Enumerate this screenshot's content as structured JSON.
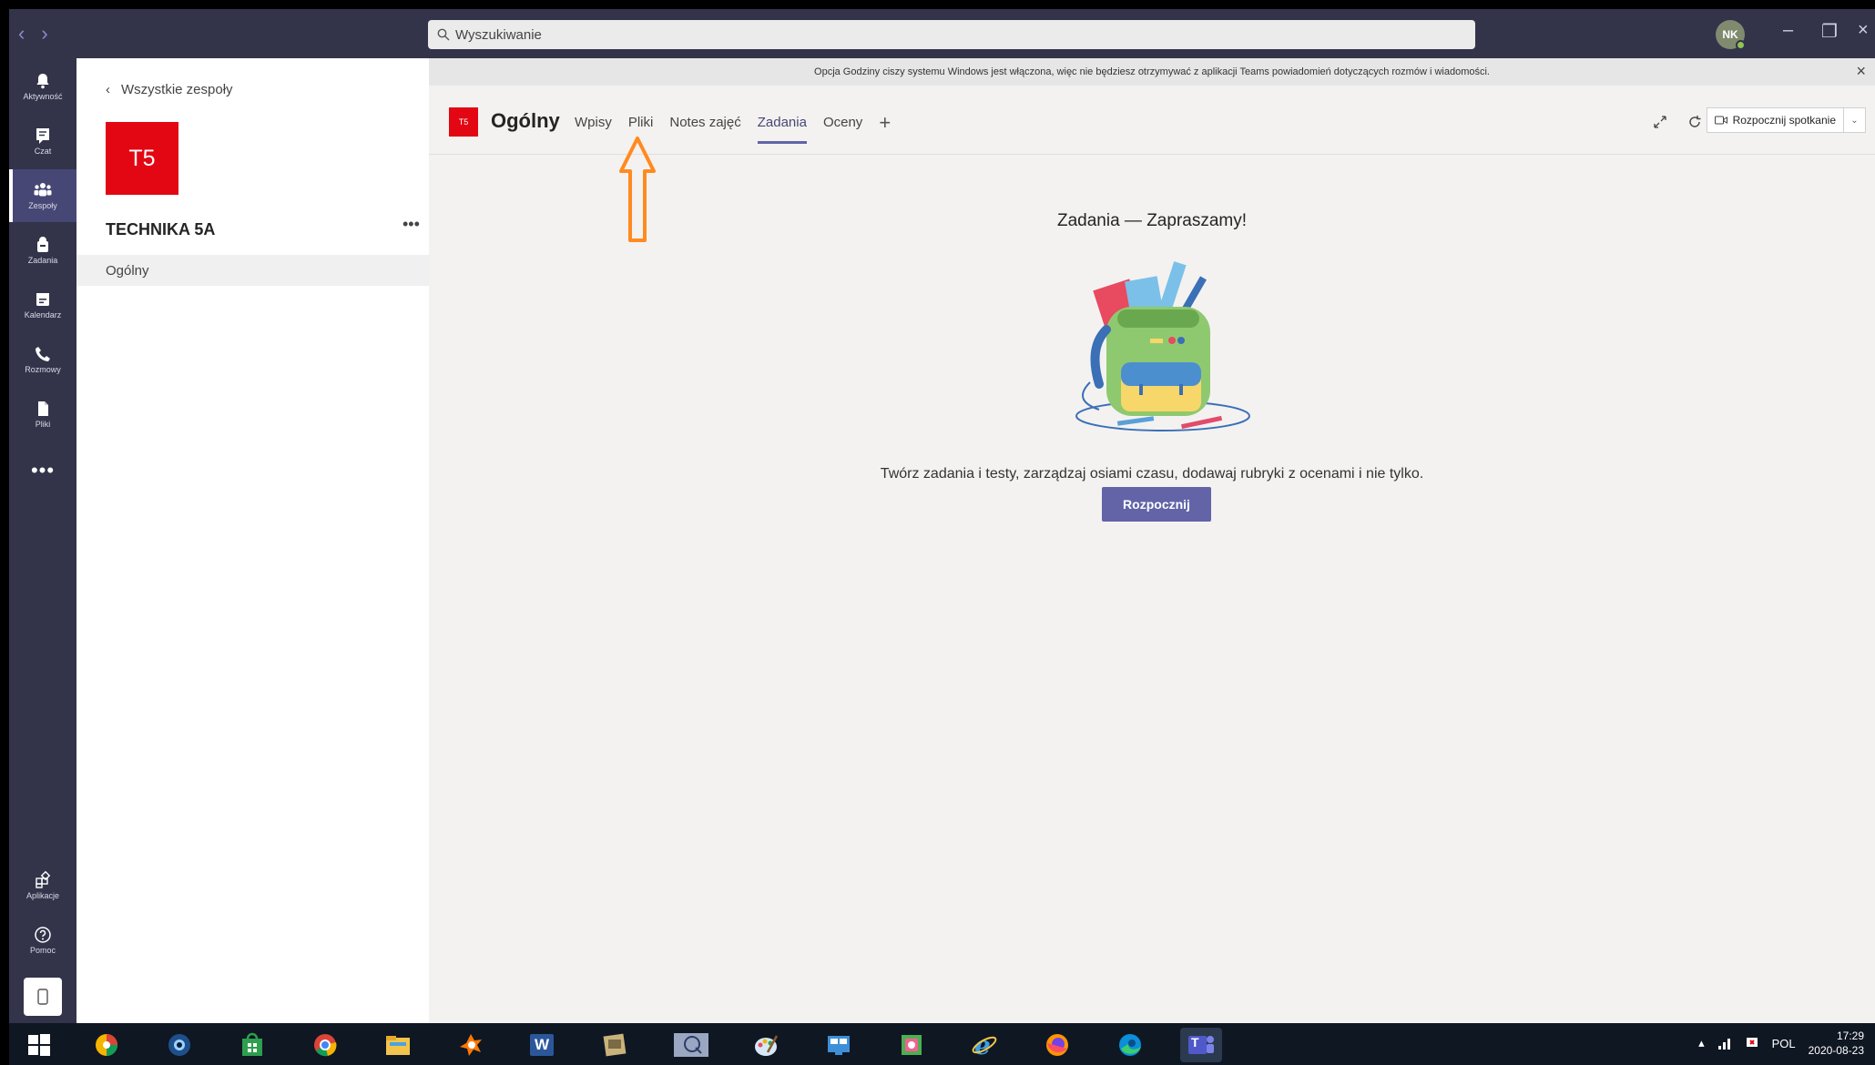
{
  "titlebar": {
    "search_placeholder": "Wyszukiwanie",
    "avatar_initials": "NK",
    "back_arrow": "‹",
    "forward_arrow": "›",
    "minimize": "–",
    "restore": "❐",
    "close": "×"
  },
  "rail": {
    "items": [
      {
        "label": "Aktywność",
        "icon": "bell-icon"
      },
      {
        "label": "Czat",
        "icon": "chat-icon"
      },
      {
        "label": "Zespoły",
        "icon": "teams-icon"
      },
      {
        "label": "Zadania",
        "icon": "assignments-icon"
      },
      {
        "label": "Kalendarz",
        "icon": "calendar-icon"
      },
      {
        "label": "Rozmowy",
        "icon": "phone-icon"
      },
      {
        "label": "Pliki",
        "icon": "file-icon"
      }
    ],
    "more": "•••",
    "bottom": [
      {
        "label": "Aplikacje",
        "icon": "apps-icon"
      },
      {
        "label": "Pomoc",
        "icon": "help-icon"
      }
    ]
  },
  "teampanel": {
    "back_label": "Wszystkie zespoły",
    "team_initials": "T5",
    "team_name": "TECHNIKA 5A",
    "more": "•••",
    "channels": [
      "Ogólny"
    ]
  },
  "notification": {
    "text": "Opcja Godziny ciszy systemu Windows jest włączona, więc nie będziesz otrzymywać z aplikacji Teams powiadomień dotyczących rozmów i wiadomości.",
    "close": "×"
  },
  "channel": {
    "badge": "T5",
    "title": "Ogólny",
    "tabs": [
      "Wpisy",
      "Pliki",
      "Notes zajęć",
      "Zadania",
      "Oceny"
    ],
    "active_tab": "Zadania",
    "add_tab": "+",
    "meet_label": "Rozpocznij spotkanie"
  },
  "main": {
    "welcome_title": "Zadania — Zapraszamy!",
    "description": "Twórz zadania i testy, zarządzaj osiami czasu, dodawaj rubryki z ocenami i nie tylko.",
    "start_button": "Rozpocznij"
  },
  "taskbar": {
    "apps": [
      "windows-start-icon",
      "picasa-icon",
      "webcam-icon",
      "store-icon",
      "chrome-icon",
      "explorer-icon",
      "avast-icon",
      "word-icon",
      "scan-icon",
      "app-icon",
      "paint-icon",
      "network-icon",
      "photo-icon",
      "ie-icon",
      "firefox-icon",
      "edge-icon",
      "teams-icon"
    ],
    "word_letter": "W",
    "teams_letter": "T",
    "language": "POL",
    "time": "17:29",
    "date": "2020-08-23"
  },
  "colors": {
    "rail": "#33344a",
    "accent": "#6264a7",
    "team_red": "#e30613",
    "annotation": "#ff8a1f"
  }
}
